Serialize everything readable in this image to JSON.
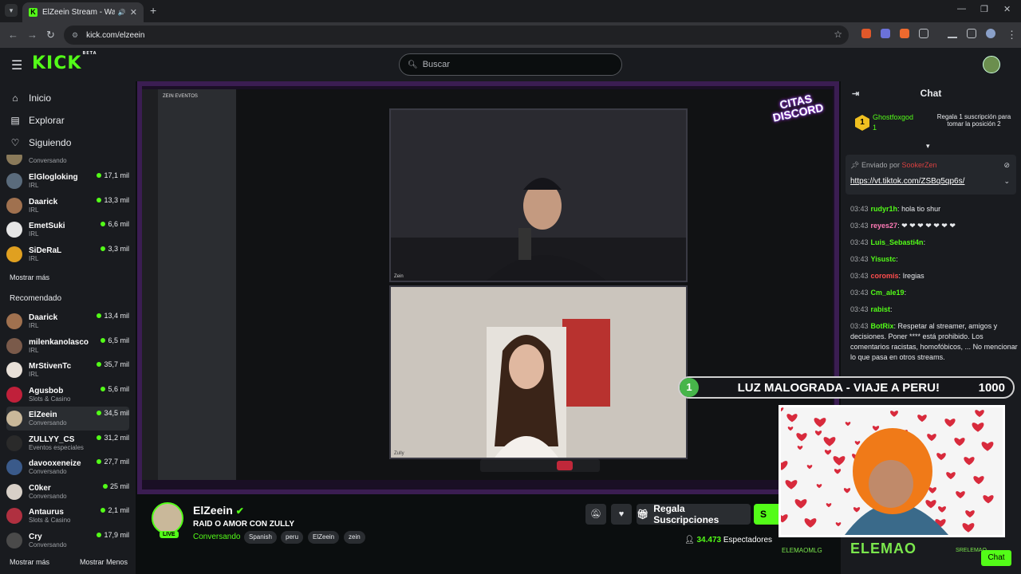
{
  "browser": {
    "tab_title": "ElZeein Stream - Watch Live",
    "url": "kick.com/elzeein",
    "new_tab": "+",
    "win_min": "—",
    "win_max": "❐",
    "win_close": "✕"
  },
  "header": {
    "logo": "KICK",
    "beta": "BETA",
    "search_placeholder": "Buscar"
  },
  "nav": {
    "items": [
      {
        "label": "Inicio"
      },
      {
        "label": "Explorar"
      },
      {
        "label": "Siguiendo"
      }
    ]
  },
  "following": {
    "partial_category": "Conversando",
    "channels": [
      {
        "name": "ElGlogloking",
        "category": "IRL",
        "viewers": "17,1 mil",
        "color": "#5a6b7c"
      },
      {
        "name": "Daarick",
        "category": "IRL",
        "viewers": "13,3 mil",
        "color": "#a0714f"
      },
      {
        "name": "EmetSuki",
        "category": "IRL",
        "viewers": "6,6 mil",
        "color": "#e6e6e6"
      },
      {
        "name": "SiDeRaL",
        "category": "IRL",
        "viewers": "3,3 mil",
        "color": "#e0a020"
      }
    ],
    "show_more": "Mostrar más"
  },
  "recommended": {
    "title": "Recomendado",
    "channels": [
      {
        "name": "Daarick",
        "category": "IRL",
        "viewers": "13,4 mil",
        "color": "#a0714f"
      },
      {
        "name": "milenkanolasco",
        "category": "IRL",
        "viewers": "6,5 mil",
        "color": "#7a5a4a"
      },
      {
        "name": "MrStivenTc",
        "category": "IRL",
        "viewers": "35,7 mil",
        "color": "#e8e0d8"
      },
      {
        "name": "Agusbob",
        "category": "Slots & Casino",
        "viewers": "5,6 mil",
        "color": "#c0203a"
      },
      {
        "name": "ElZeein",
        "category": "Conversando",
        "viewers": "34,5 mil",
        "color": "#c9b89a"
      },
      {
        "name": "ZULLYY_CS",
        "category": "Eventos especiales",
        "viewers": "31,2 mil",
        "color": "#2a2a2a"
      },
      {
        "name": "davooxeneize",
        "category": "Conversando",
        "viewers": "27,7 mil",
        "color": "#3a5a8a"
      },
      {
        "name": "C0ker",
        "category": "Conversando",
        "viewers": "25 mil",
        "color": "#d8d0c8"
      },
      {
        "name": "Antaurus",
        "category": "Slots & Casino",
        "viewers": "2,1 mil",
        "color": "#b03040"
      },
      {
        "name": "Cry",
        "category": "Conversando",
        "viewers": "17,9 mil",
        "color": "#4a4a4a"
      }
    ],
    "show_more": "Mostrar más",
    "show_less": "Mostrar Menos"
  },
  "player": {
    "discord_server": "ZEIN EVENTOS",
    "overlay_title": "CITAS DISCORD",
    "banner_num": "1",
    "banner_text": "LUZ MALOGRADA - VIAJE A PERU!",
    "banner_count": "1000",
    "overlay_brand": "ELEMAO",
    "cam1_label": "Zein",
    "cam2_label": "Zully"
  },
  "stream": {
    "channel": "ElZeein",
    "live": "LIVE",
    "title": "RAID O AMOR CON ZULLY",
    "category": "Conversando",
    "tags": [
      "Spanish",
      "peru",
      "ElZeein",
      "zein"
    ],
    "gift_label": "Regala Suscripciones",
    "sub_label": "S",
    "viewer_count": "34.473",
    "viewer_label": "Espectadores"
  },
  "chat": {
    "title": "Chat",
    "gifter_name": "Ghostfoxgod",
    "gifter_count": "1",
    "gifter_text": "Regala 1 suscripción para tomar la posición 2",
    "pinned_by": "Enviado por",
    "pinned_user": "SookerZen",
    "pinned_link": "https://vt.tiktok.com/ZSBq5qp6s/",
    "messages": [
      {
        "time": "03:43",
        "user": "rudyr1h",
        "color": "#53fc18",
        "text": "hola tio shur"
      },
      {
        "time": "03:43",
        "user": "reyes27",
        "color": "#ff7ab6",
        "text": "❤ ❤ ❤ ❤ ❤ ❤ ❤"
      },
      {
        "time": "03:43",
        "user": "Luis_Sebasti4n",
        "color": "#53fc18",
        "text": ""
      },
      {
        "time": "03:43",
        "user": "Yisustc",
        "color": "#53fc18",
        "text": ""
      },
      {
        "time": "03:43",
        "user": "coromis",
        "color": "#ff4d4d",
        "text": "Iregias"
      },
      {
        "time": "03:43",
        "user": "Cm_ale19",
        "color": "#53fc18",
        "text": ""
      },
      {
        "time": "03:43",
        "user": "rabist",
        "color": "#53fc18",
        "text": ""
      },
      {
        "time": "03:43",
        "user": "BotRix",
        "color": "#53fc18",
        "text": "Respetar al streamer, amigos y decisiones. Poner **** está prohibido. Los comentarios racistas, homofóbicos, ... No mencionar lo que pasa en otros streams."
      }
    ],
    "bottom_handle": "ELEMAOMLG",
    "bottom_user": "SRELEMAO",
    "chat_button": "Chat"
  }
}
